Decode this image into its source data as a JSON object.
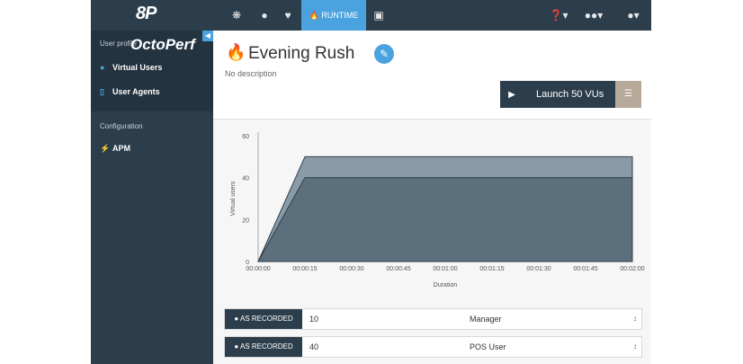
{
  "brand": "8P",
  "nav": {
    "active_label": "RUNTIME",
    "help_caret": "▾",
    "team_caret": "▾",
    "user_caret": "▾"
  },
  "sidebar": {
    "logo": "OctoPerf",
    "section1": "User profile",
    "items1": [
      {
        "label": "Virtual Users",
        "icon": "user-icon"
      },
      {
        "label": "User Agents",
        "icon": "mobile-icon"
      }
    ],
    "section2": "Configuration",
    "items2": [
      {
        "label": "APM",
        "icon": "plug-icon"
      }
    ]
  },
  "scenario": {
    "title": "Evening Rush",
    "description": "No description",
    "launch_label": "Launch 50 VUs"
  },
  "chart_data": {
    "type": "area",
    "xlabel": "Duration",
    "ylabel": "Virtual users",
    "x": [
      "00:00:00",
      "00:00:15",
      "00:00:30",
      "00:00:45",
      "00:01:00",
      "00:01:15",
      "00:01:30",
      "00:01:45",
      "00:02:00"
    ],
    "ylim": [
      0,
      60
    ],
    "yticks": [
      0,
      20,
      40,
      60
    ],
    "series": [
      {
        "values": [
          0,
          50,
          50,
          50,
          50,
          50,
          50,
          50,
          50
        ],
        "color": "#8a9ba8"
      },
      {
        "values": [
          0,
          40,
          40,
          40,
          40,
          40,
          40,
          40,
          40
        ],
        "color": "#5c6f7d"
      }
    ]
  },
  "rows": [
    {
      "tag": "AS RECORDED",
      "value": "10",
      "select": "Manager"
    },
    {
      "tag": "AS RECORDED",
      "value": "40",
      "select": "POS User"
    }
  ],
  "colors": {
    "navbar": "#2c3e4c",
    "accent": "#4aa3df"
  }
}
